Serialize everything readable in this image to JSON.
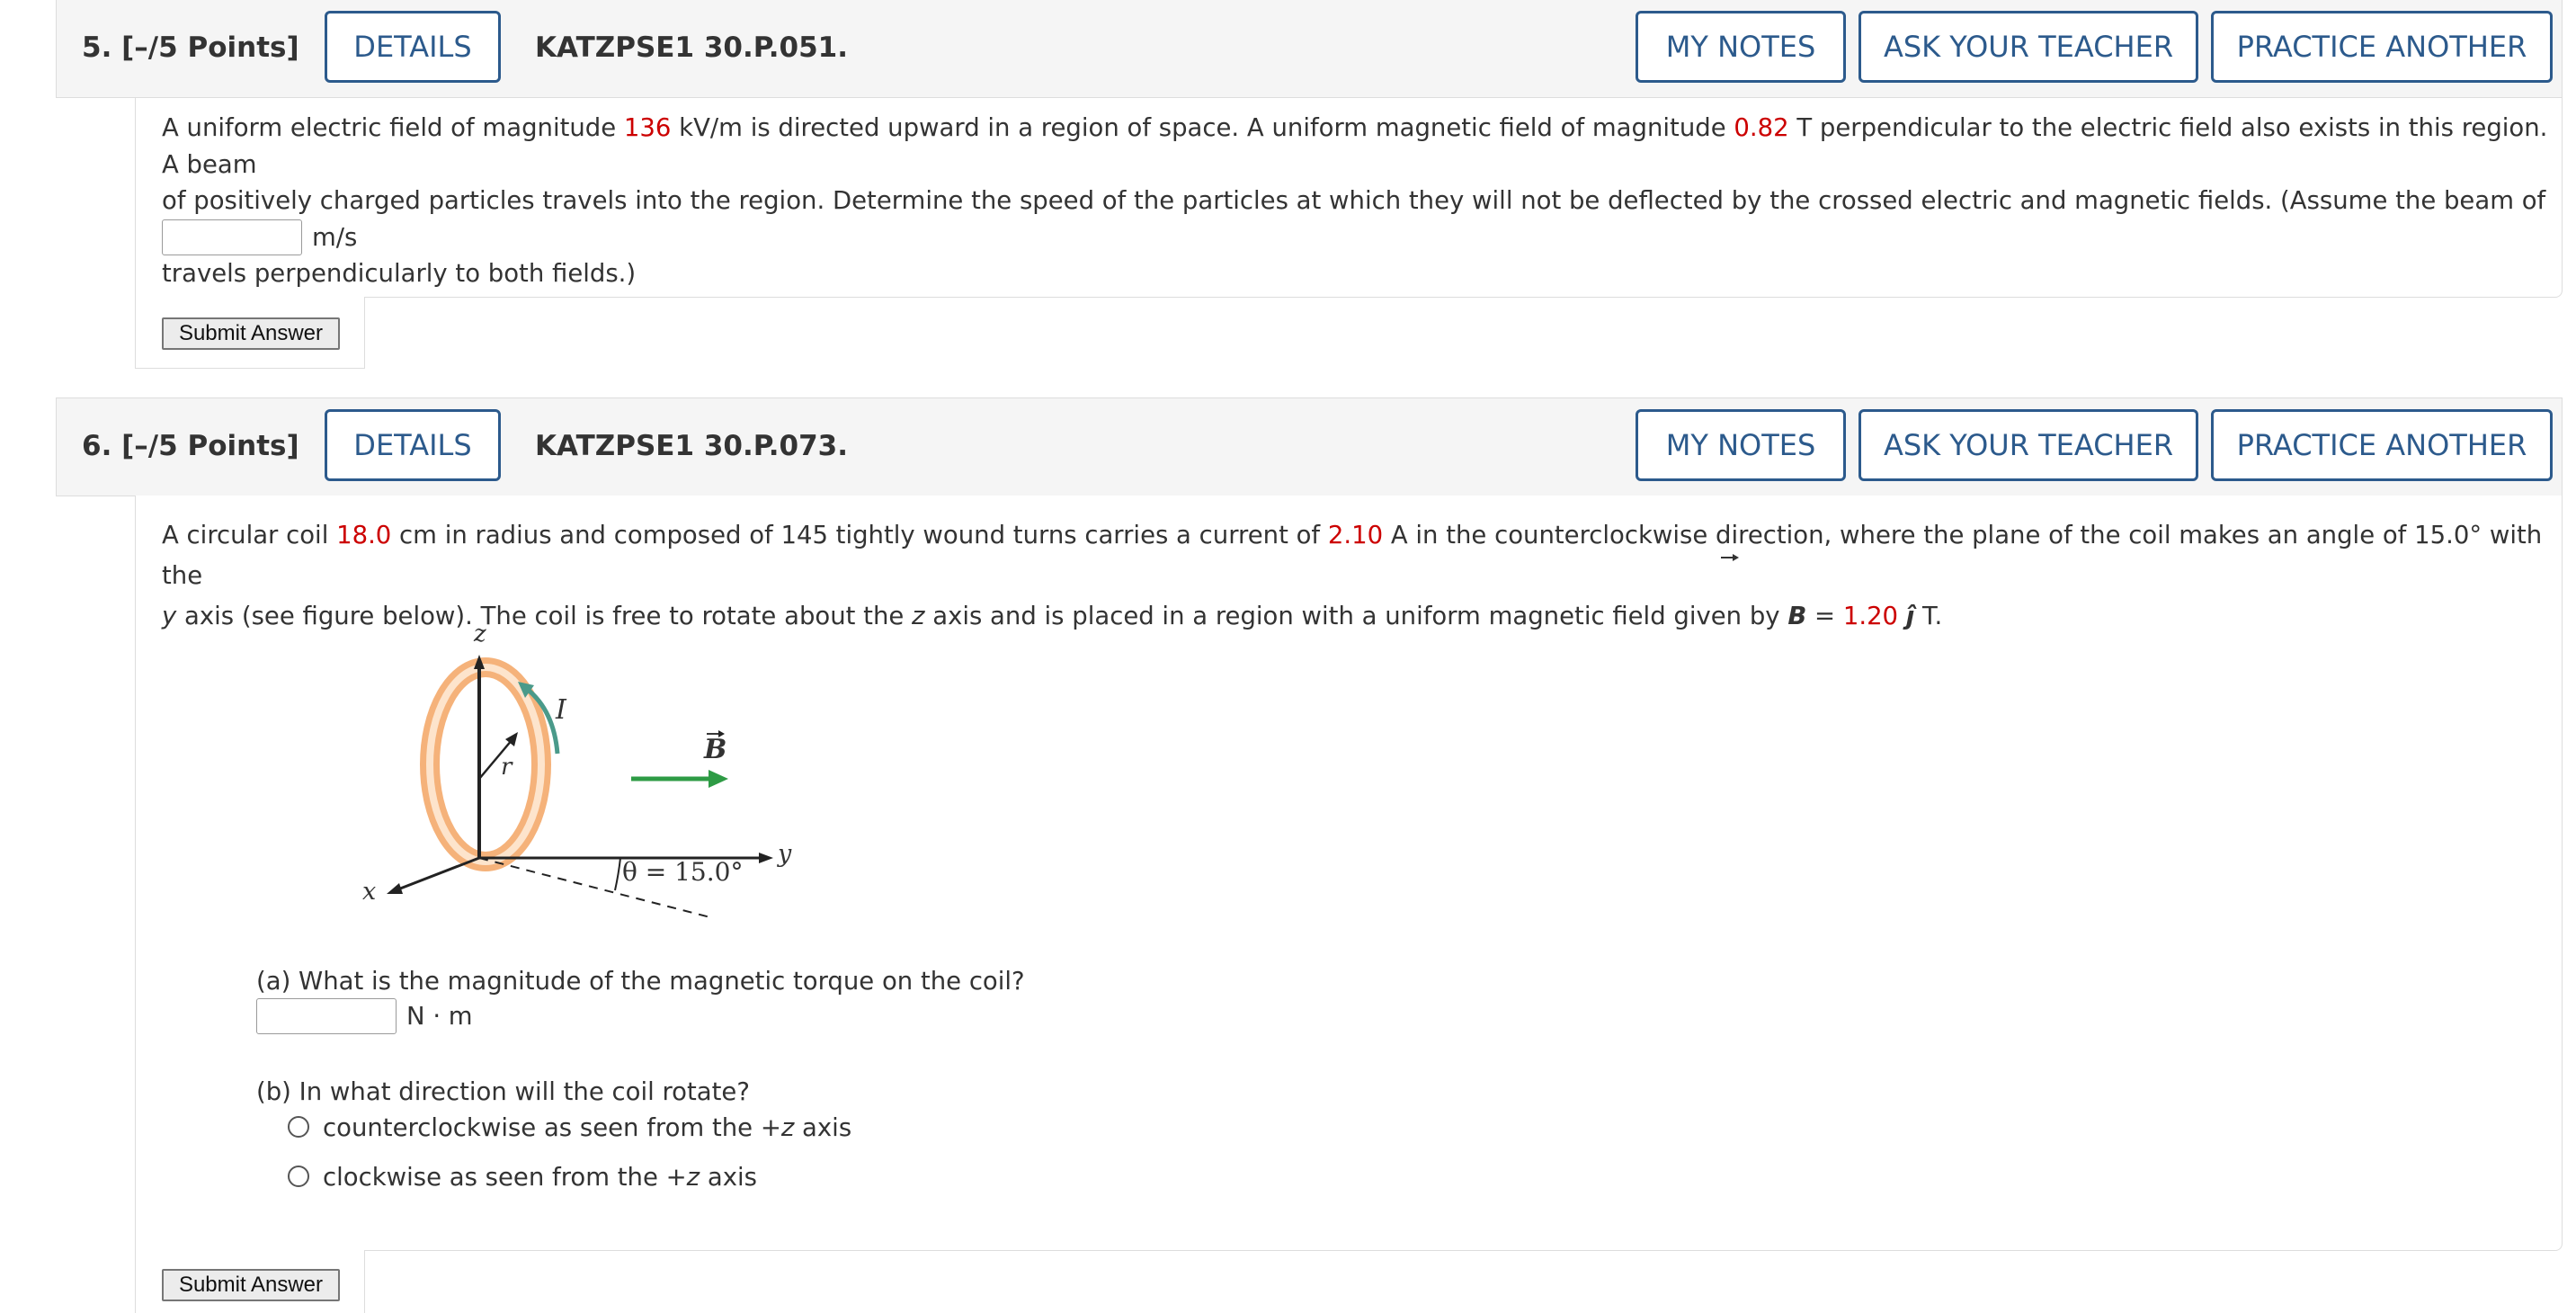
{
  "q5": {
    "points": "5. [–/5 Points]",
    "details_label": "DETAILS",
    "id": "KATZPSE1 30.P.051.",
    "my_notes_label": "MY NOTES",
    "ask_teacher_label": "ASK YOUR TEACHER",
    "practice_label": "PRACTICE ANOTHER",
    "text": {
      "p1": "A uniform electric field of magnitude ",
      "v1": "136",
      "p2": " kV/m is directed upward in a region of space. A uniform magnetic field of magnitude ",
      "v2": "0.82",
      "p3": " T perpendicular to the electric field also exists in this region. A beam",
      "line2": "of positively charged particles travels into the region. Determine the speed of the particles at which they will not be deflected by the crossed electric and magnetic fields. (Assume the beam of particles",
      "line3": "travels perpendicularly to both fields.)"
    },
    "answer_value": "",
    "unit": "m/s",
    "submit_label": "Submit Answer"
  },
  "q6": {
    "points": "6. [–/5 Points]",
    "details_label": "DETAILS",
    "id": "KATZPSE1 30.P.073.",
    "my_notes_label": "MY NOTES",
    "ask_teacher_label": "ASK YOUR TEACHER",
    "practice_label": "PRACTICE ANOTHER",
    "text": {
      "p1": "A circular coil ",
      "v1": "18.0",
      "p2": " cm in radius and composed of 145 tightly wound turns carries a current of ",
      "v2": "2.10",
      "p3": " A in the counterclockwise direction, where the plane of the coil makes an angle of 15.0° with the",
      "l2_y": "y",
      "l2a": " axis (see figure below). The coil is free to rotate about the ",
      "l2_z": "z",
      "l2b": " axis and is placed in a region with a uniform magnetic field given by ",
      "l2_B": "B",
      "l2_eq": " = ",
      "v3": "1.20",
      "l2_j": "ĵ",
      "l2_end": " T."
    },
    "figure": {
      "z_label": "z",
      "x_label": "x",
      "y_label": "y",
      "r_label": "r",
      "i_label": "I",
      "b_label": "B",
      "angle_label": "θ = 15.0°",
      "coil_color": "#f5b27a",
      "field_arrow_color": "#2e9b45",
      "current_arrow_color": "#4a9a8a"
    },
    "part_a": {
      "question": "(a) What is the magnitude of the magnetic torque on the coil?",
      "answer_value": "",
      "unit": "N · m"
    },
    "part_b": {
      "question": "(b) In what direction will the coil rotate?",
      "options": [
        {
          "pre": "counterclockwise as seen from the +",
          "var": "z",
          "post": " axis"
        },
        {
          "pre": "clockwise as seen from the +",
          "var": "z",
          "post": " axis"
        }
      ]
    },
    "submit_label": "Submit Answer"
  }
}
